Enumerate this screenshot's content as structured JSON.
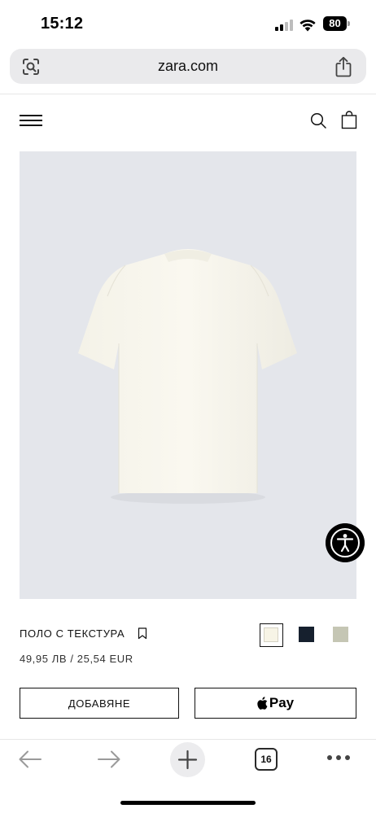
{
  "status_bar": {
    "time": "15:12",
    "battery_level": "80"
  },
  "browser": {
    "url": "zara.com",
    "open_tabs": "16"
  },
  "product": {
    "name": "ПОЛО С ТЕКСТУРА",
    "price": "49,95 ЛВ / 25,54 EUR",
    "image_icon": "shirt-photo",
    "colors": [
      {
        "name": "off-white",
        "hex": "#f7f4e6",
        "selected": true
      },
      {
        "name": "navy",
        "hex": "#16202e",
        "selected": false
      },
      {
        "name": "sage",
        "hex": "#c5c6b4",
        "selected": false
      }
    ]
  },
  "actions": {
    "add_label": "ДОБАВЯНЕ",
    "pay_label": "Pay"
  },
  "icons": {
    "menu": "hamburger-menu-icon",
    "search": "search-icon",
    "bag": "shopping-bag-icon",
    "bookmark": "bookmark-icon",
    "accessibility": "accessibility-icon",
    "back": "back-arrow-icon",
    "forward": "forward-arrow-icon",
    "new_tab": "plus-icon",
    "more": "more-dots-icon"
  },
  "colors": {
    "image_background": "#e4e6eb",
    "address_bar": "#eaeaec"
  }
}
